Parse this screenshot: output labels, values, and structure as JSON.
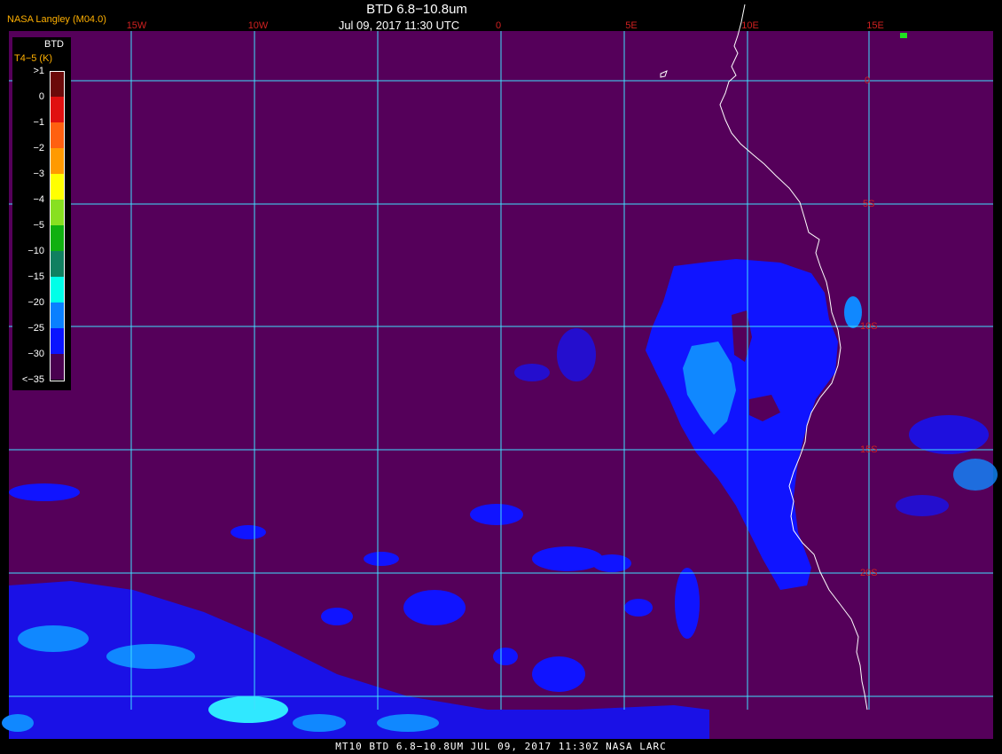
{
  "header": {
    "title": "BTD 6.8−10.8um",
    "date": "Jul 09, 2017 11:30 UTC",
    "source": "NASA Langley (M04.0)"
  },
  "footer": {
    "text": "MT10  BTD 6.8−10.8UM   JUL 09, 2017 11:30Z   NASA LARC"
  },
  "longitude_labels": [
    "15W",
    "10W",
    "0",
    "5E",
    "10E",
    "15E"
  ],
  "latitude_labels": [
    "0",
    "5S",
    "10S",
    "15S",
    "20S"
  ],
  "legend": {
    "title": "BTD",
    "subtitle": "T4−5 (K)",
    "labels": [
      ">1",
      "0",
      "−1",
      "−2",
      "−3",
      "−4",
      "−5",
      "−10",
      "−15",
      "−20",
      "−25",
      "−30",
      "<−35"
    ],
    "colors": [
      "#6b0a0a",
      "#e01010",
      "#ff6010",
      "#ff9a00",
      "#ffff00",
      "#88e020",
      "#10b010",
      "#108060",
      "#00ffe8",
      "#0a80ff",
      "#0a14ff",
      "#4a0050"
    ]
  },
  "colors": {
    "background": "#55005a",
    "grid": "#40e0ff",
    "coast": "#ffffff",
    "cloud_dark": "#1014ff",
    "cloud_mid": "#1088ff",
    "cloud_light": "#30e8ff"
  }
}
